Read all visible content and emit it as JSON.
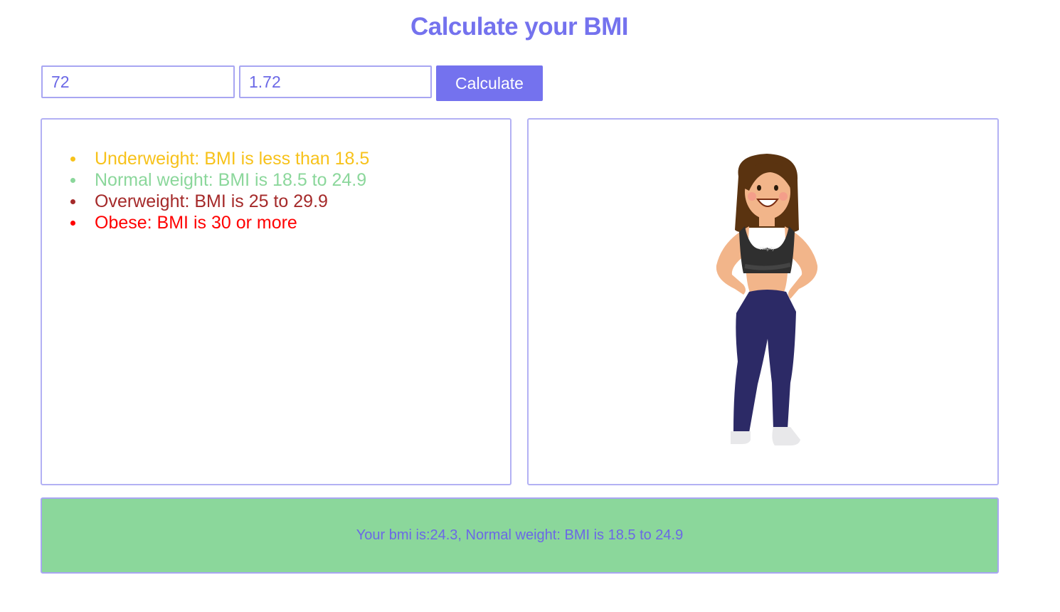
{
  "title": "Calculate your BMI",
  "form": {
    "weight_value": "72",
    "height_value": "1.72",
    "calculate_label": "Calculate"
  },
  "legend": {
    "items": [
      {
        "label": "Underweight: BMI is less than 18.5",
        "color": "#f7c21b"
      },
      {
        "label": "Normal weight: BMI is 18.5 to 24.9",
        "color": "#8bd79b"
      },
      {
        "label": "Overweight: BMI is 25 to 29.9",
        "color": "#a52a2a"
      },
      {
        "label": "Obese: BMI is 30 or more",
        "color": "#ff0000"
      }
    ]
  },
  "figure": {
    "icon": "woman-fitness-illustration",
    "shirt_text": "integrity"
  },
  "result": {
    "text": "Your bmi is:24.3, Normal weight: BMI is 18.5 to 24.9",
    "background": "#8bd79b"
  },
  "theme": {
    "accent": "#7472ee"
  }
}
